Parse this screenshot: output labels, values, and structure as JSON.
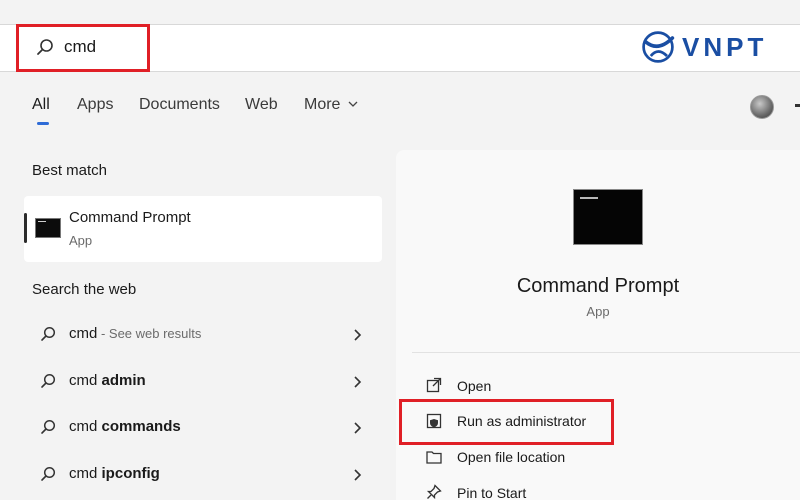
{
  "search": {
    "query": "cmd"
  },
  "logo": {
    "text": "VNPT"
  },
  "tabs": [
    {
      "label": "All"
    },
    {
      "label": "Apps"
    },
    {
      "label": "Documents"
    },
    {
      "label": "Web"
    },
    {
      "label": "More"
    }
  ],
  "left": {
    "best_match_heading": "Best match",
    "best_match": {
      "title": "Command Prompt",
      "subtitle": "App"
    },
    "search_web_heading": "Search the web",
    "web_results": [
      {
        "prefix": "cmd",
        "bold": "",
        "hint": " - See web results"
      },
      {
        "prefix": "cmd ",
        "bold": "admin",
        "hint": ""
      },
      {
        "prefix": "cmd ",
        "bold": "commands",
        "hint": ""
      },
      {
        "prefix": "cmd ",
        "bold": "ipconfig",
        "hint": ""
      }
    ]
  },
  "right": {
    "title": "Command Prompt",
    "subtitle": "App",
    "actions": [
      {
        "label": "Open",
        "icon": "open-external-icon"
      },
      {
        "label": "Run as administrator",
        "icon": "shield-icon"
      },
      {
        "label": "Open file location",
        "icon": "folder-icon"
      },
      {
        "label": "Pin to Start",
        "icon": "pin-icon"
      }
    ]
  },
  "colors": {
    "highlight": "#e01f26",
    "accent": "#2e6bd6",
    "logo": "#1a4ea3"
  }
}
